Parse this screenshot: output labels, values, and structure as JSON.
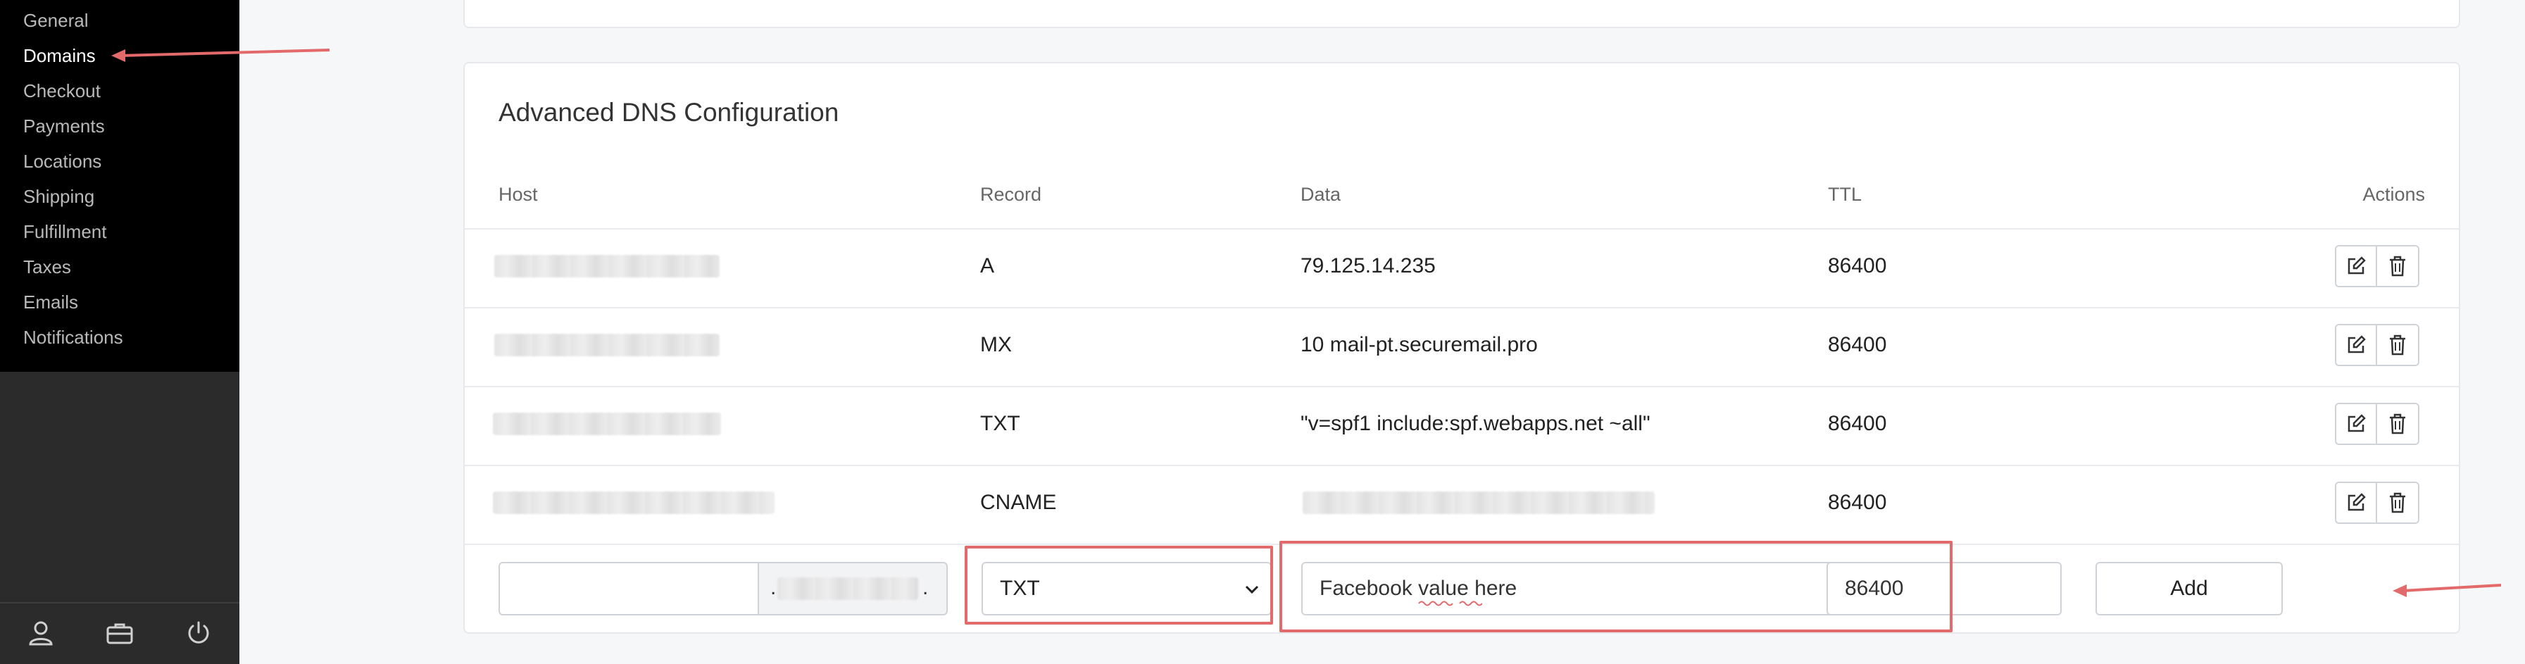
{
  "sidebar": {
    "items": [
      {
        "label": "General"
      },
      {
        "label": "Domains"
      },
      {
        "label": "Checkout"
      },
      {
        "label": "Payments"
      },
      {
        "label": "Locations"
      },
      {
        "label": "Shipping"
      },
      {
        "label": "Fulfillment"
      },
      {
        "label": "Taxes"
      },
      {
        "label": "Emails"
      },
      {
        "label": "Notifications"
      }
    ],
    "active_index": 1,
    "footer_icons": [
      "user-icon",
      "briefcase-icon",
      "power-icon"
    ]
  },
  "dns": {
    "title": "Advanced DNS Configuration",
    "columns": {
      "host": "Host",
      "record": "Record",
      "data": "Data",
      "ttl": "TTL",
      "actions": "Actions"
    },
    "rows": [
      {
        "record": "A",
        "data": "79.125.14.235",
        "ttl": "86400"
      },
      {
        "record": "MX",
        "data": "10 mail-pt.securemail.pro",
        "ttl": "86400"
      },
      {
        "record": "TXT",
        "data": "\"v=spf1 include:spf.webapps.net ~all\"",
        "ttl": "86400"
      },
      {
        "record": "CNAME",
        "data": "",
        "ttl": "86400"
      }
    ],
    "add_row": {
      "host_value": "",
      "host_suffix": ".",
      "record_selected": "TXT",
      "data_value": "Facebook value here",
      "ttl_value": "86400",
      "add_label": "Add"
    }
  },
  "colors": {
    "sidebar_bg": "#000000",
    "highlight": "#e36a6a",
    "page_bg": "#f6f7f9"
  }
}
